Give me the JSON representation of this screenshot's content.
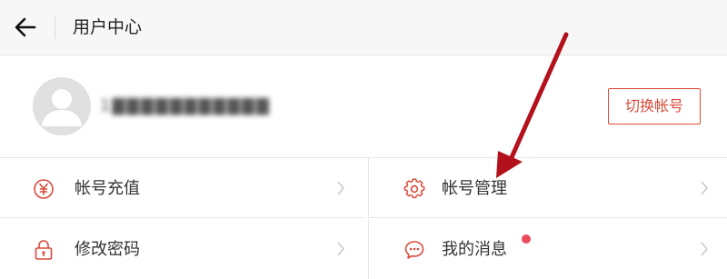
{
  "header": {
    "title": "用户中心",
    "back_icon": "arrow-left-icon"
  },
  "profile": {
    "username": "1▇▇▇▇▇▇▇▇▇▇▇",
    "avatar_icon": "user-avatar-icon",
    "switch_label": "切换帐号"
  },
  "menu": {
    "items": [
      {
        "label": "帐号充值",
        "icon": "yen-circle-icon"
      },
      {
        "label": "帐号管理",
        "icon": "gear-icon"
      },
      {
        "label": "修改密码",
        "icon": "lock-icon"
      },
      {
        "label": "我的消息",
        "icon": "chat-bubble-icon",
        "badge": true
      }
    ]
  },
  "colors": {
    "accent": "#d94a3a",
    "badge": "#e94b5c",
    "annotation_arrow": "#b3121c",
    "header_bg": "#f7f7f7"
  }
}
